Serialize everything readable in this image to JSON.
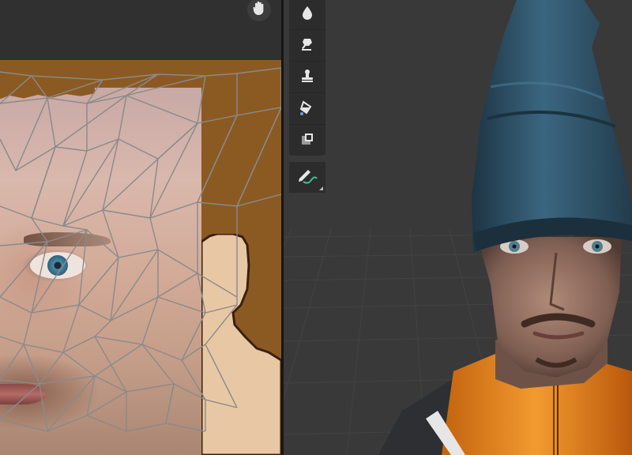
{
  "uv_editor": {
    "header_tool": "hand-pan-icon",
    "texture_content": "face-texture-with-uv-mesh"
  },
  "viewport": {
    "tools": [
      {
        "name": "blur-drop-icon"
      },
      {
        "name": "smear-icon"
      },
      {
        "name": "clone-stamp-icon"
      },
      {
        "name": "fill-bucket-icon"
      },
      {
        "name": "mask-icon"
      }
    ],
    "annotate_tool": "annotate-pencil-icon"
  },
  "colors": {
    "texture_background": "#8b5a22",
    "hat": "#2f5468",
    "jacket_orange": "#e07c1a",
    "jacket_dark": "#2d2f33",
    "viewport_bg": "#393939"
  }
}
